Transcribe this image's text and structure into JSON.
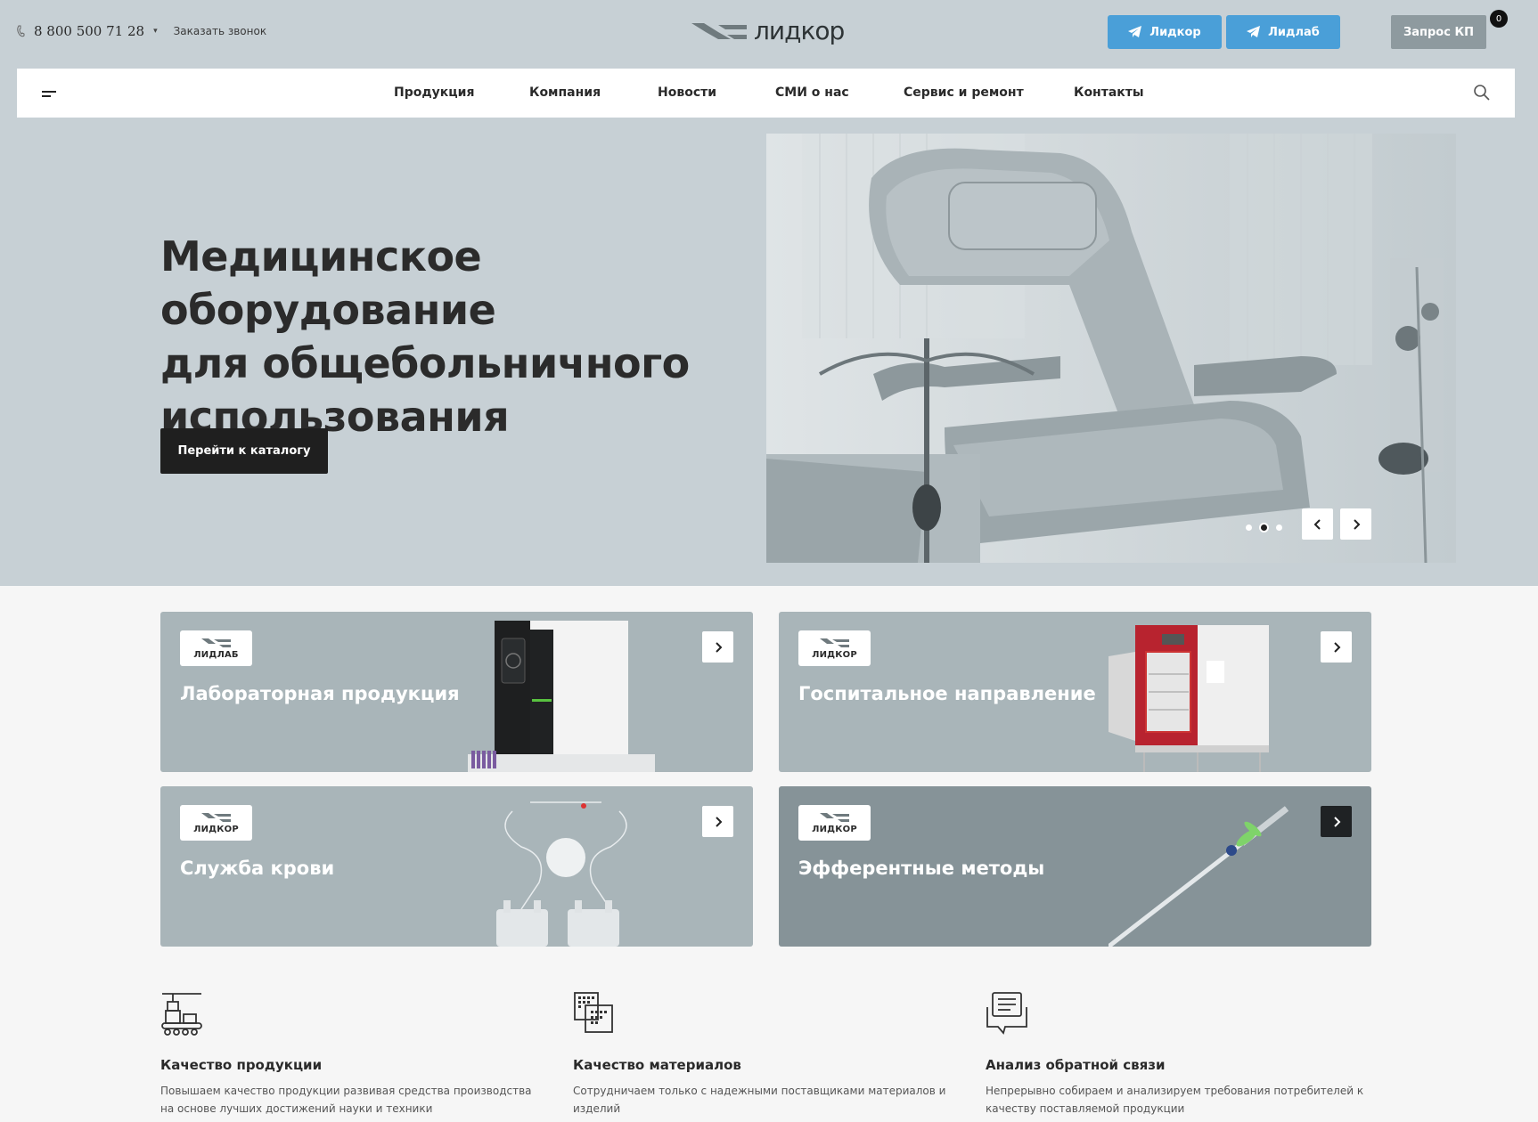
{
  "header": {
    "phone": "8 800 500 71 28",
    "callback_label": "Заказать звонок",
    "logo_text": "лидкор",
    "telegram_buttons": [
      "Лидкор",
      "Лидлаб"
    ],
    "quote_button": "Запрос КП",
    "cart_count": "0"
  },
  "nav": {
    "items": [
      "Продукция",
      "Компания",
      "Новости",
      "СМИ о нас",
      "Сервис и ремонт",
      "Контакты"
    ]
  },
  "hero": {
    "title_lines": [
      "Медицинское оборудование",
      "для общебольничного",
      "использования"
    ],
    "cta_label": "Перейти к каталогу",
    "slider": {
      "slides": 3,
      "active_slide": 2
    }
  },
  "cards": [
    {
      "brand": "ЛИДЛАБ",
      "title": "Лабораторная продукция"
    },
    {
      "brand": "ЛИДКОР",
      "title": "Госпитальное направление"
    },
    {
      "brand": "ЛИДКОР",
      "title": "Служба крови"
    },
    {
      "brand": "ЛИДКОР",
      "title": "Эфферентные методы"
    }
  ],
  "features": [
    {
      "icon": "conveyor-production-icon",
      "title": "Качество продукции",
      "desc_lines": [
        "Повышаем качество продукции развивая средства производства",
        "на основе лучших достижений науки и техники"
      ]
    },
    {
      "icon": "materials-documents-icon",
      "title": "Качество материалов",
      "desc_lines": [
        "Сотрудничаем только с надежными поставщиками материалов и",
        "изделий"
      ]
    },
    {
      "icon": "feedback-chat-icon",
      "title": "Анализ обратной связи",
      "desc_lines": [
        "Непрерывно собираем и анализируем требования потребителей к",
        "качеству поставляемой продукции"
      ]
    }
  ],
  "colors": {
    "hero_bg": "#c7d0d5",
    "telegram_blue": "#4a9fd8",
    "quote_gray": "#8e9a9f",
    "card_bg": "#a9b5b9",
    "card_dark_bg": "#869398",
    "dark": "#1f1f1f"
  }
}
